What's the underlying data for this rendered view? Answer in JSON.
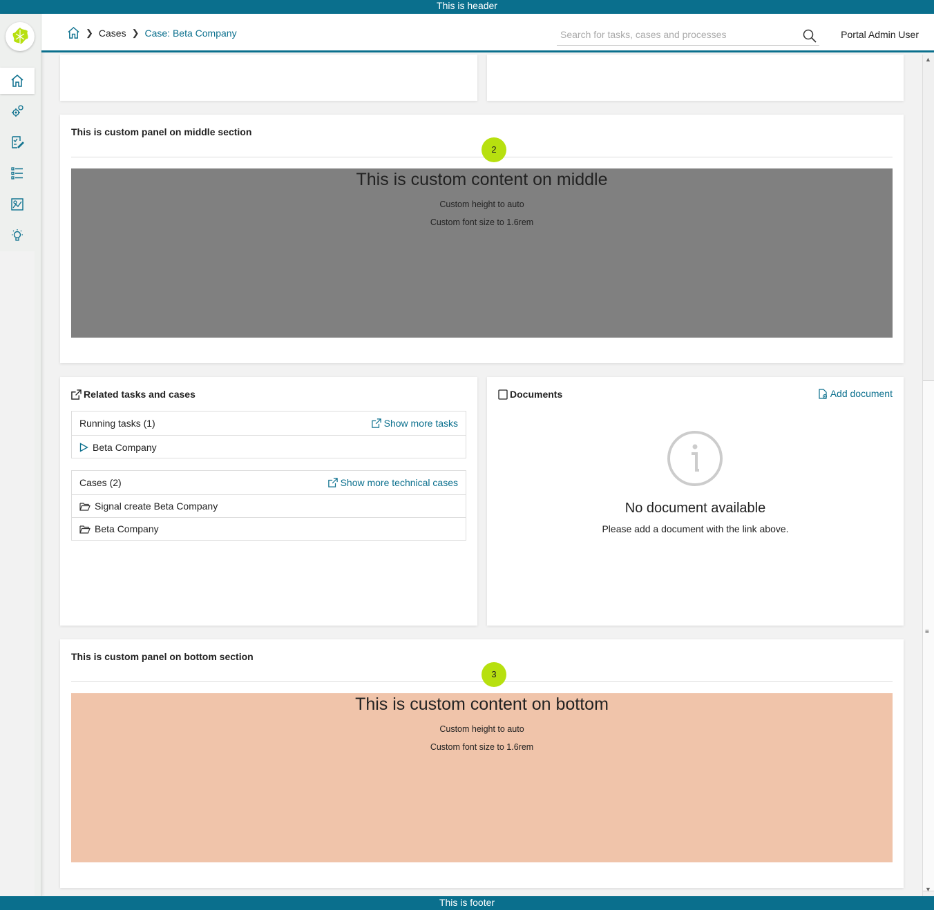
{
  "app": {
    "header_text": "This is header",
    "footer_text": "This is footer"
  },
  "sidebar": {
    "items": [
      {
        "name": "home-icon",
        "active": true
      },
      {
        "name": "processes-icon"
      },
      {
        "name": "tasks-icon"
      },
      {
        "name": "cases-icon"
      },
      {
        "name": "statistics-icon"
      },
      {
        "name": "ideas-icon"
      }
    ]
  },
  "navbar": {
    "breadcrumb": [
      "Cases",
      "Case: Beta Company"
    ],
    "search_placeholder": "Search for tasks, cases and processes",
    "user": "Portal Admin User"
  },
  "middle_panel": {
    "title": "This is custom panel on middle section",
    "badge": "2",
    "content_heading": "This is custom content on middle",
    "line1": "Custom height to auto",
    "line2": "Custom font size to 1.6rem",
    "bg_color": "#808080"
  },
  "related": {
    "title": "Related tasks and cases",
    "running_header": "Running tasks (1)",
    "show_more_tasks": "Show more tasks",
    "tasks": [
      "Beta Company"
    ],
    "cases_header": "Cases (2)",
    "show_more_cases": "Show more technical cases",
    "cases": [
      "Signal create Beta Company",
      "Beta Company"
    ]
  },
  "documents": {
    "title": "Documents",
    "add_link": "Add document",
    "empty_title": "No document available",
    "empty_text": "Please add a document with the link above."
  },
  "bottom_panel": {
    "title": "This is custom panel on bottom section",
    "badge": "3",
    "content_heading": "This is custom content on bottom",
    "line1": "Custom height to auto",
    "line2": "Custom font size to 1.6rem",
    "bg_color": "#f0c4aa"
  },
  "colors": {
    "brand": "#0a6f8d",
    "badge": "#b7e00f"
  }
}
